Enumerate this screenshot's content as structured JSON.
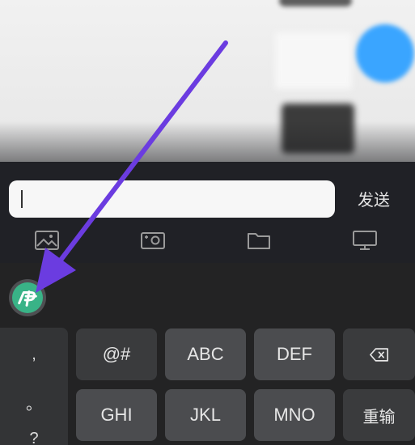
{
  "input_bar": {
    "text_value": "",
    "send_label": "发送",
    "tools": [
      "image-icon",
      "camera-icon",
      "folder-icon",
      "screen-icon"
    ]
  },
  "keyboard": {
    "logo": "swype-logo-icon",
    "punctuation": [
      ",",
      "。",
      "?"
    ],
    "rows": [
      [
        "@#",
        "ABC",
        "DEF",
        "backspace-icon"
      ],
      [
        "GHI",
        "JKL",
        "MNO",
        "重输"
      ]
    ]
  },
  "colors": {
    "arrow": "#6b3ce0",
    "logo_green": "#39b387",
    "avatar_blue": "#3aa5ff"
  }
}
